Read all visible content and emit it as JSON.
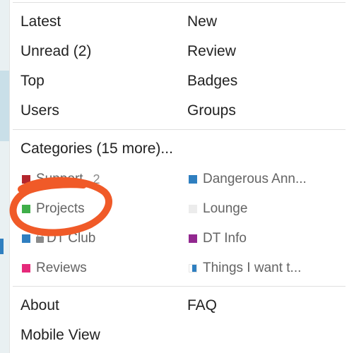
{
  "nav": {
    "latest": "Latest",
    "new": "New",
    "unread": "Unread (2)",
    "review": "Review",
    "top": "Top",
    "badges": "Badges",
    "users": "Users",
    "groups": "Groups"
  },
  "categories": {
    "heading": "Categories (15 more)...",
    "items": [
      {
        "name": "Support",
        "count": "2",
        "color": "#b3262d"
      },
      {
        "name": "Dangerous Ann...",
        "color": "#2f7fc0"
      },
      {
        "name": "Projects",
        "color": "#3fae49"
      },
      {
        "name": "Lounge",
        "color": "#ececec"
      },
      {
        "name": "DT Club",
        "color": "#2f7fc0",
        "icon": "lock-icon"
      },
      {
        "name": "DT Info",
        "color": "#92278f"
      },
      {
        "name": "Reviews",
        "color": "#e5297a"
      },
      {
        "name": "Things I want t...",
        "color": "#2f7fc0"
      }
    ]
  },
  "footer": {
    "about": "About",
    "faq": "FAQ",
    "mobile_view": "Mobile View"
  },
  "annotation": {
    "color": "#f05a28"
  }
}
